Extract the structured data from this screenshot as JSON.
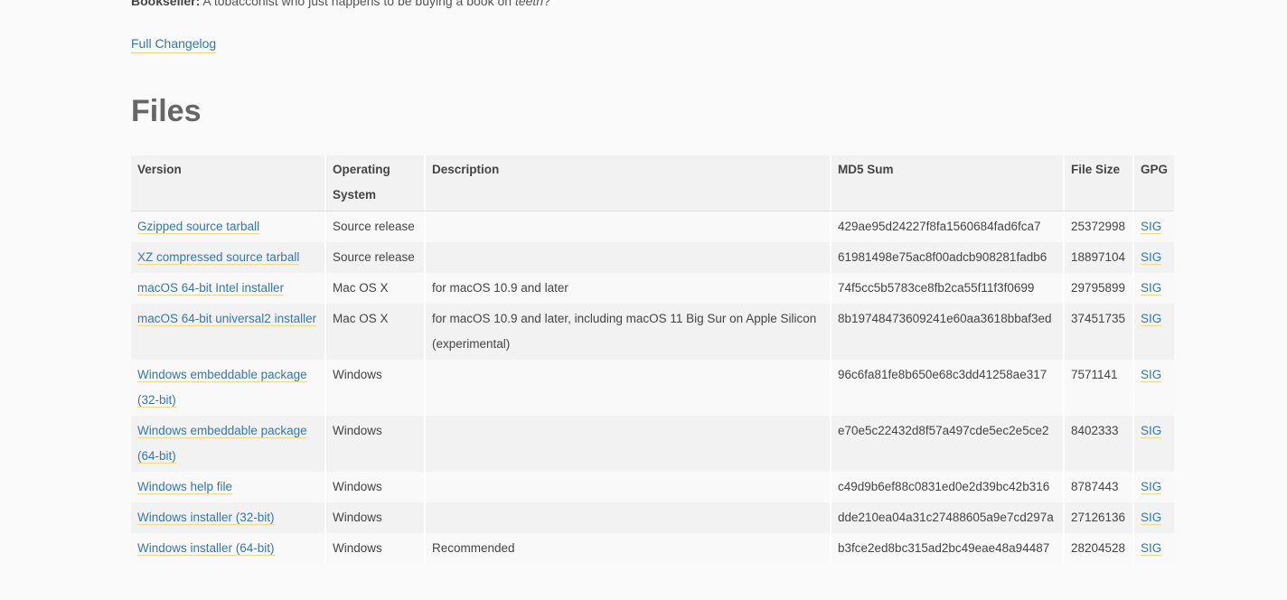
{
  "intro": {
    "speaker": "Bookseller:",
    "text_before": " A tobacconist who just happens to be buying a book on ",
    "emphasis": "teeth",
    "text_after": "?"
  },
  "changelog_link": "Full Changelog",
  "files_heading": "Files",
  "table": {
    "headers": {
      "version": "Version",
      "os": "Operating System",
      "description": "Description",
      "md5": "MD5 Sum",
      "size": "File Size",
      "gpg": "GPG"
    },
    "rows": [
      {
        "version": "Gzipped source tarball",
        "os": "Source release",
        "description": "",
        "md5": "429ae95d24227f8fa1560684fad6fca7",
        "size": "25372998",
        "gpg": "SIG"
      },
      {
        "version": "XZ compressed source tarball",
        "os": "Source release",
        "description": "",
        "md5": "61981498e75ac8f00adcb908281fadb6",
        "size": "18897104",
        "gpg": "SIG"
      },
      {
        "version": "macOS 64-bit Intel installer",
        "os": "Mac OS X",
        "description": "for macOS 10.9 and later",
        "md5": "74f5cc5b5783ce8fb2ca55f11f3f0699",
        "size": "29795899",
        "gpg": "SIG"
      },
      {
        "version": "macOS 64-bit universal2 installer",
        "os": "Mac OS X",
        "description": "for macOS 10.9 and later, including macOS 11 Big Sur on Apple Silicon (experimental)",
        "md5": "8b19748473609241e60aa3618bbaf3ed",
        "size": "37451735",
        "gpg": "SIG"
      },
      {
        "version": "Windows embeddable package (32-bit)",
        "os": "Windows",
        "description": "",
        "md5": "96c6fa81fe8b650e68c3dd41258ae317",
        "size": "7571141",
        "gpg": "SIG"
      },
      {
        "version": "Windows embeddable package (64-bit)",
        "os": "Windows",
        "description": "",
        "md5": "e70e5c22432d8f57a497cde5ec2e5ce2",
        "size": "8402333",
        "gpg": "SIG"
      },
      {
        "version": "Windows help file",
        "os": "Windows",
        "description": "",
        "md5": "c49d9b6ef88c0831ed0e2d39bc42b316",
        "size": "8787443",
        "gpg": "SIG"
      },
      {
        "version": "Windows installer (32-bit)",
        "os": "Windows",
        "description": "",
        "md5": "dde210ea04a31c27488605a9e7cd297a",
        "size": "27126136",
        "gpg": "SIG"
      },
      {
        "version": "Windows installer (64-bit)",
        "os": "Windows",
        "description": "Recommended",
        "md5": "b3fce2ed8bc315ad2bc49eae48a94487",
        "size": "28204528",
        "gpg": "SIG"
      }
    ]
  },
  "colors": {
    "link": "#3776ab",
    "link_underline": "#f5d68a",
    "heading": "#666666",
    "header_bg": "#f2f2f2",
    "row_odd_bg": "#f9f9f9",
    "row_even_bg": "#f2f2f2",
    "page_bg": "#fafafa"
  }
}
